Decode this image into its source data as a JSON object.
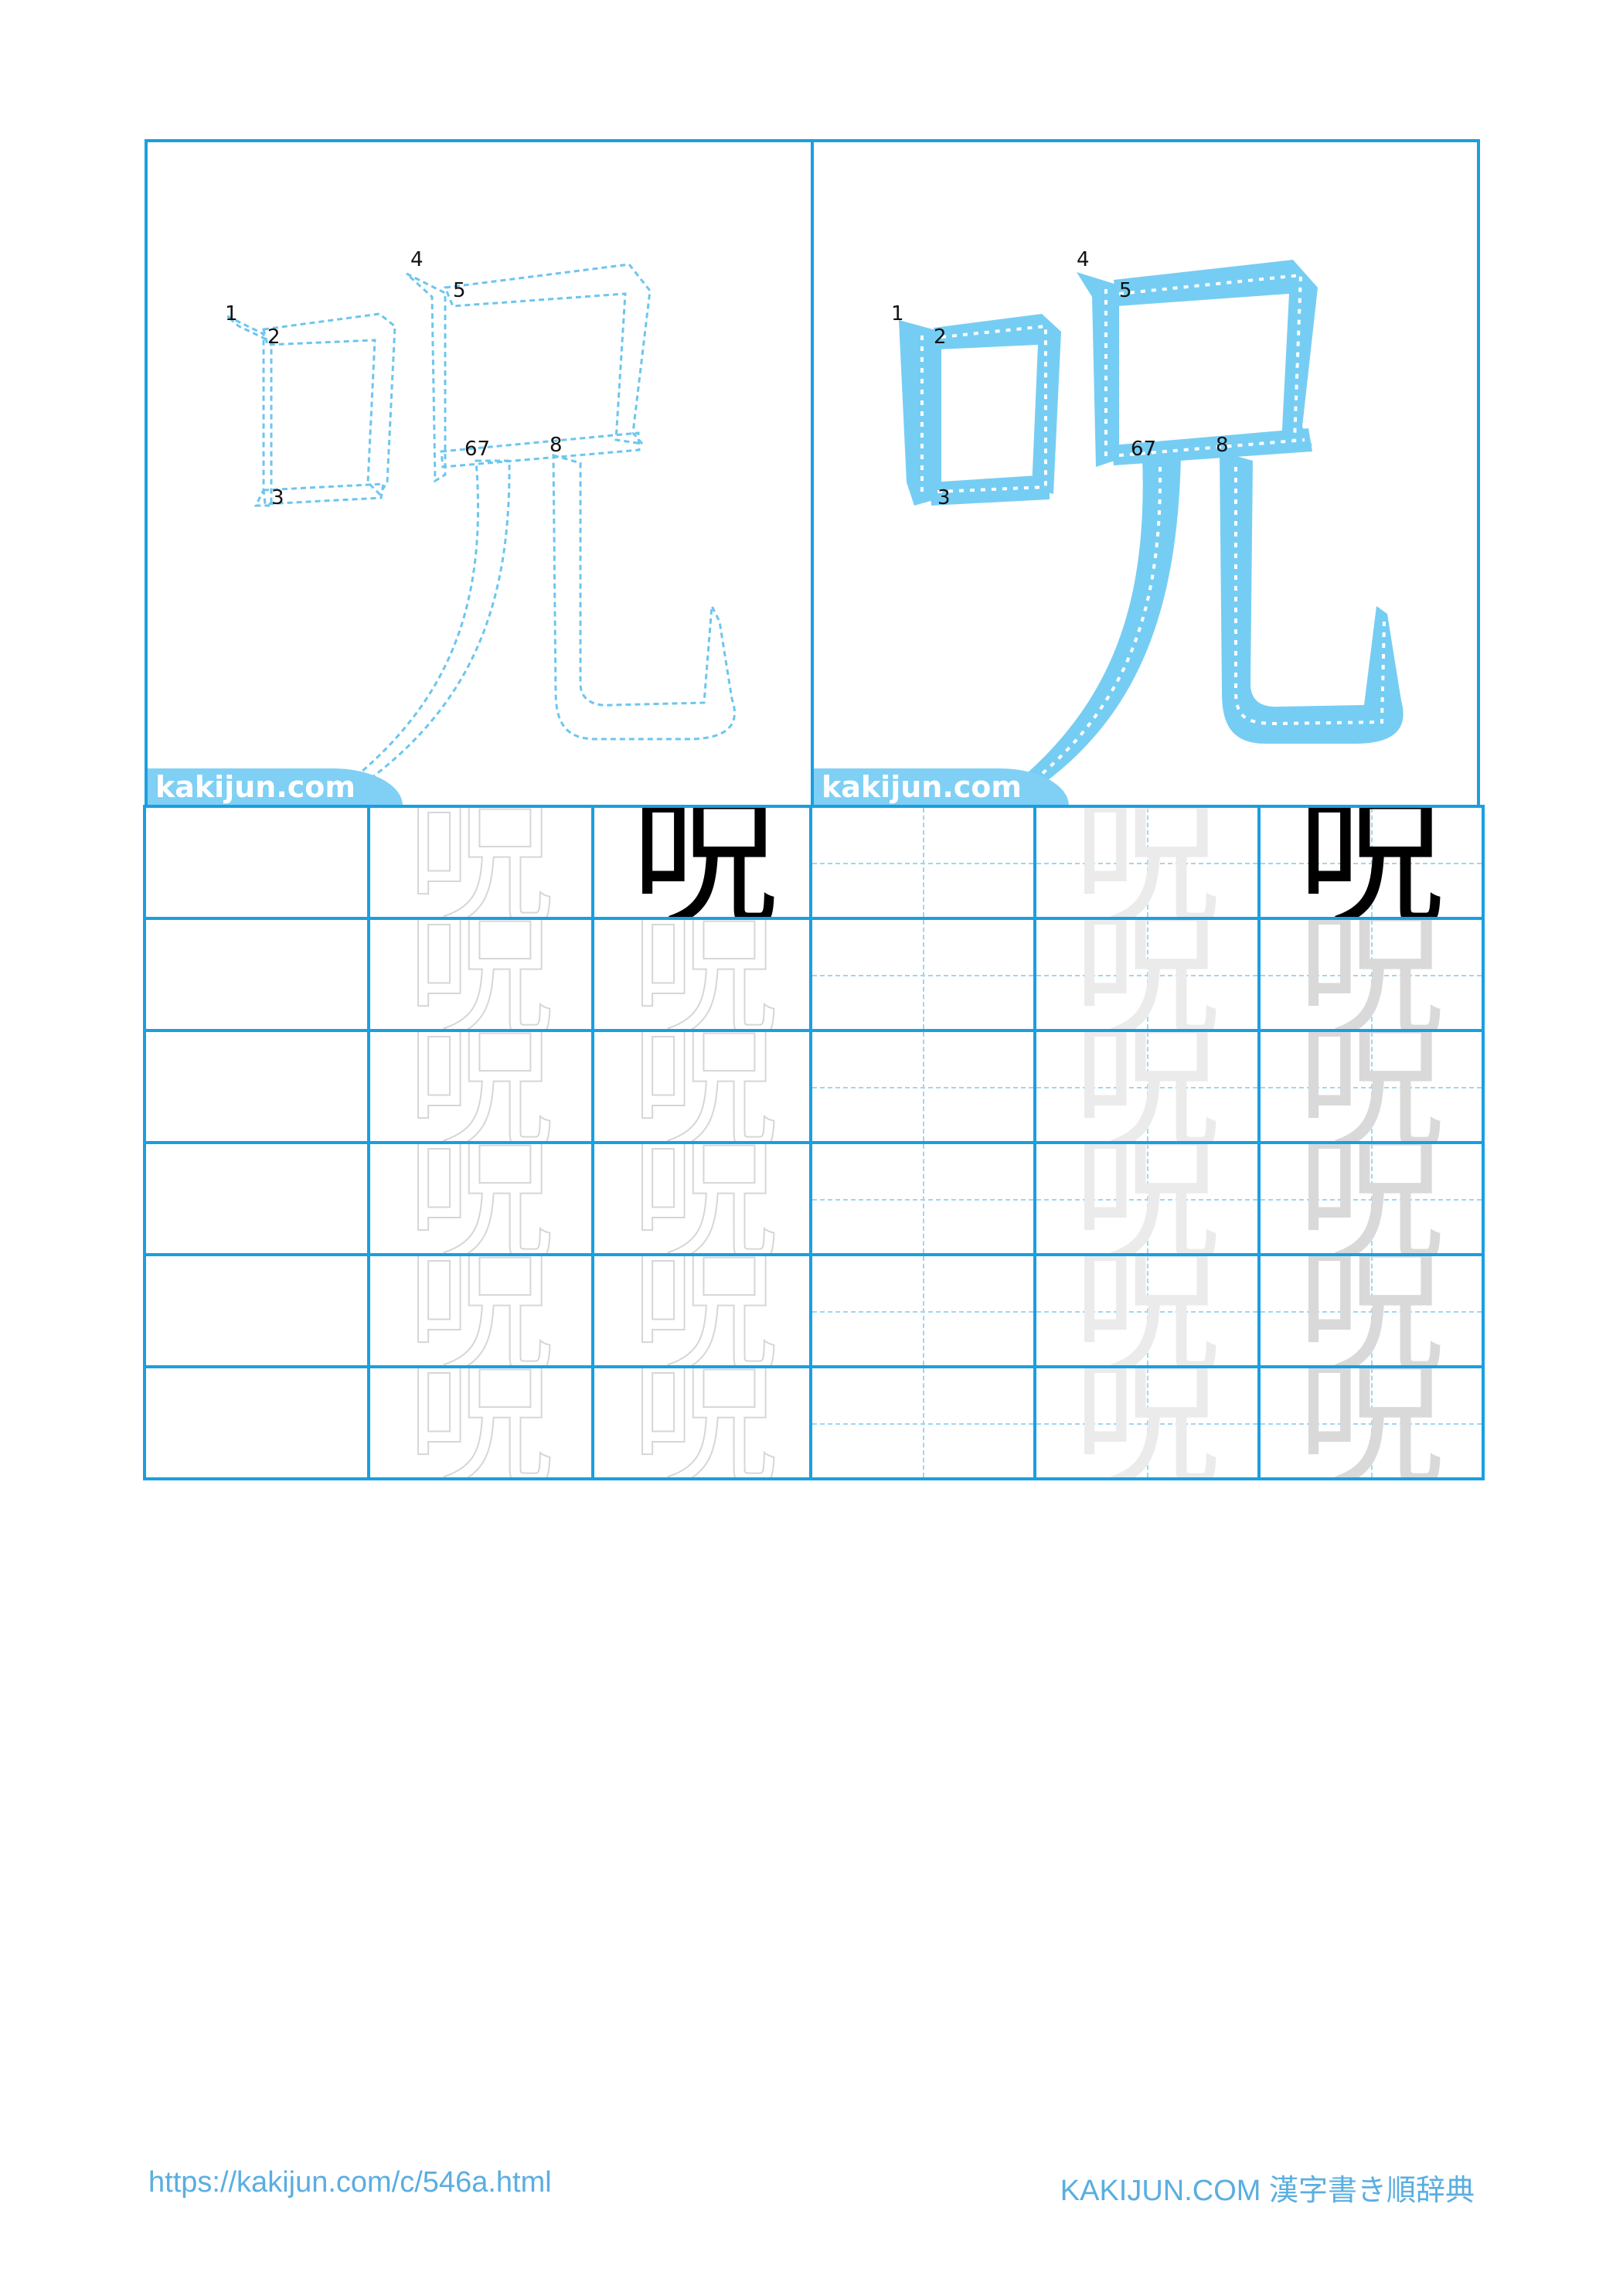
{
  "character": "呪",
  "brand_label": "kakijun.com",
  "stroke_numbers": [
    "1",
    "2",
    "3",
    "4",
    "5",
    "67",
    "8"
  ],
  "footer": {
    "url": "https://kakijun.com/c/546a.html",
    "site": "KAKIJUN.COM 漢字書き順辞典"
  },
  "colors": {
    "grid_border": "#1a9fe0",
    "stroke_fill": "#7fd0f4",
    "guide_dash": "#9fd6f2",
    "footer_text": "#5aaee0"
  }
}
